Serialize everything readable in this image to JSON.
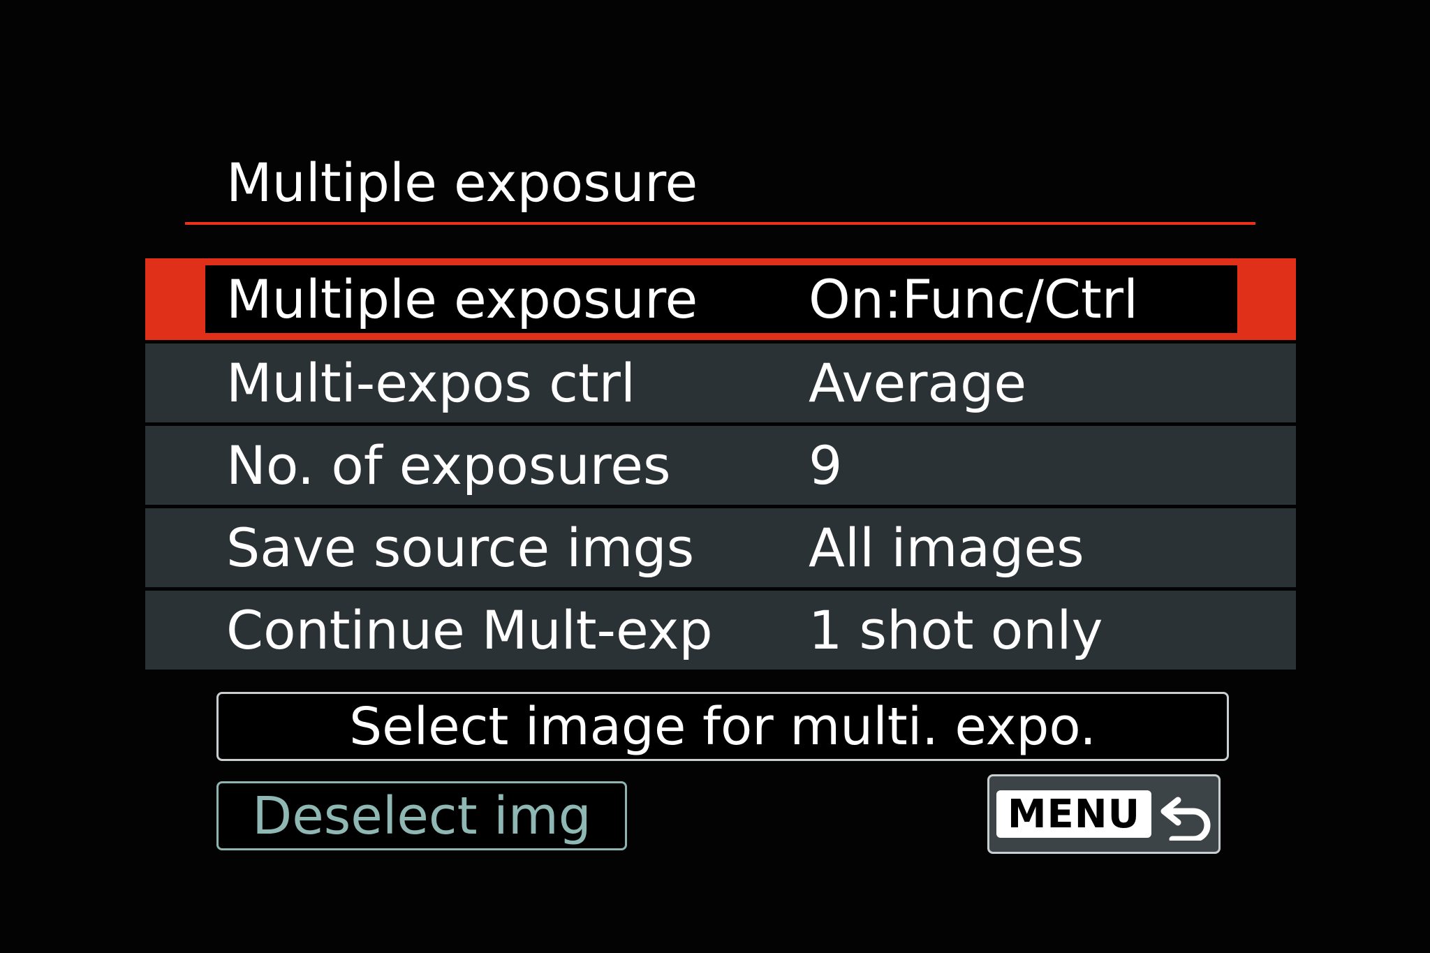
{
  "header": {
    "title": "Multiple exposure"
  },
  "menu": {
    "items": [
      {
        "label": "Multiple exposure",
        "value": "On:Func/Ctrl",
        "selected": true
      },
      {
        "label": "Multi-expos ctrl",
        "value": "Average",
        "selected": false
      },
      {
        "label": "No. of exposures",
        "value": "9",
        "selected": false
      },
      {
        "label": "Save source imgs",
        "value": "All images",
        "selected": false
      },
      {
        "label": "Continue Mult-exp",
        "value": "1 shot only",
        "selected": false
      }
    ]
  },
  "actions": {
    "select_image_label": "Select image for multi. expo.",
    "deselect_label": "Deselect img",
    "menu_label": "MENU",
    "return_icon": "return-arrow-icon"
  },
  "colors": {
    "accent": "#e0301a",
    "row_background": "#2a3236",
    "disabled_text": "#8fb8b4",
    "background": "#000000"
  }
}
